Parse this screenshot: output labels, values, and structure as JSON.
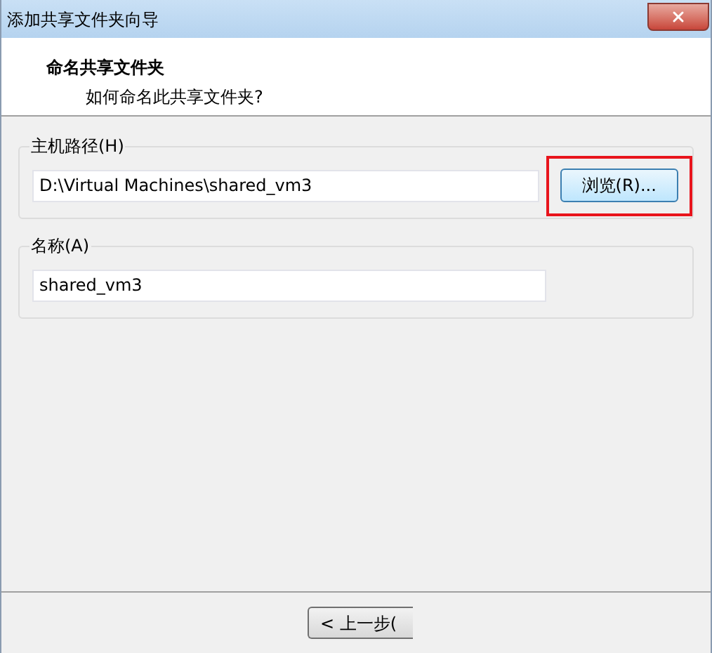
{
  "window": {
    "title": "添加共享文件夹向导"
  },
  "header": {
    "title": "命名共享文件夹",
    "subtitle": "如何命名此共享文件夹?"
  },
  "groups": [
    {
      "label": "主机路径(H)",
      "value": "D:\\Virtual Machines\\shared_vm3",
      "button": {
        "label": "浏览(R)...",
        "highlighted": true
      }
    },
    {
      "label": "名称(A)",
      "value": "shared_vm3"
    }
  ],
  "footer": {
    "back_button": "< 上一步("
  }
}
